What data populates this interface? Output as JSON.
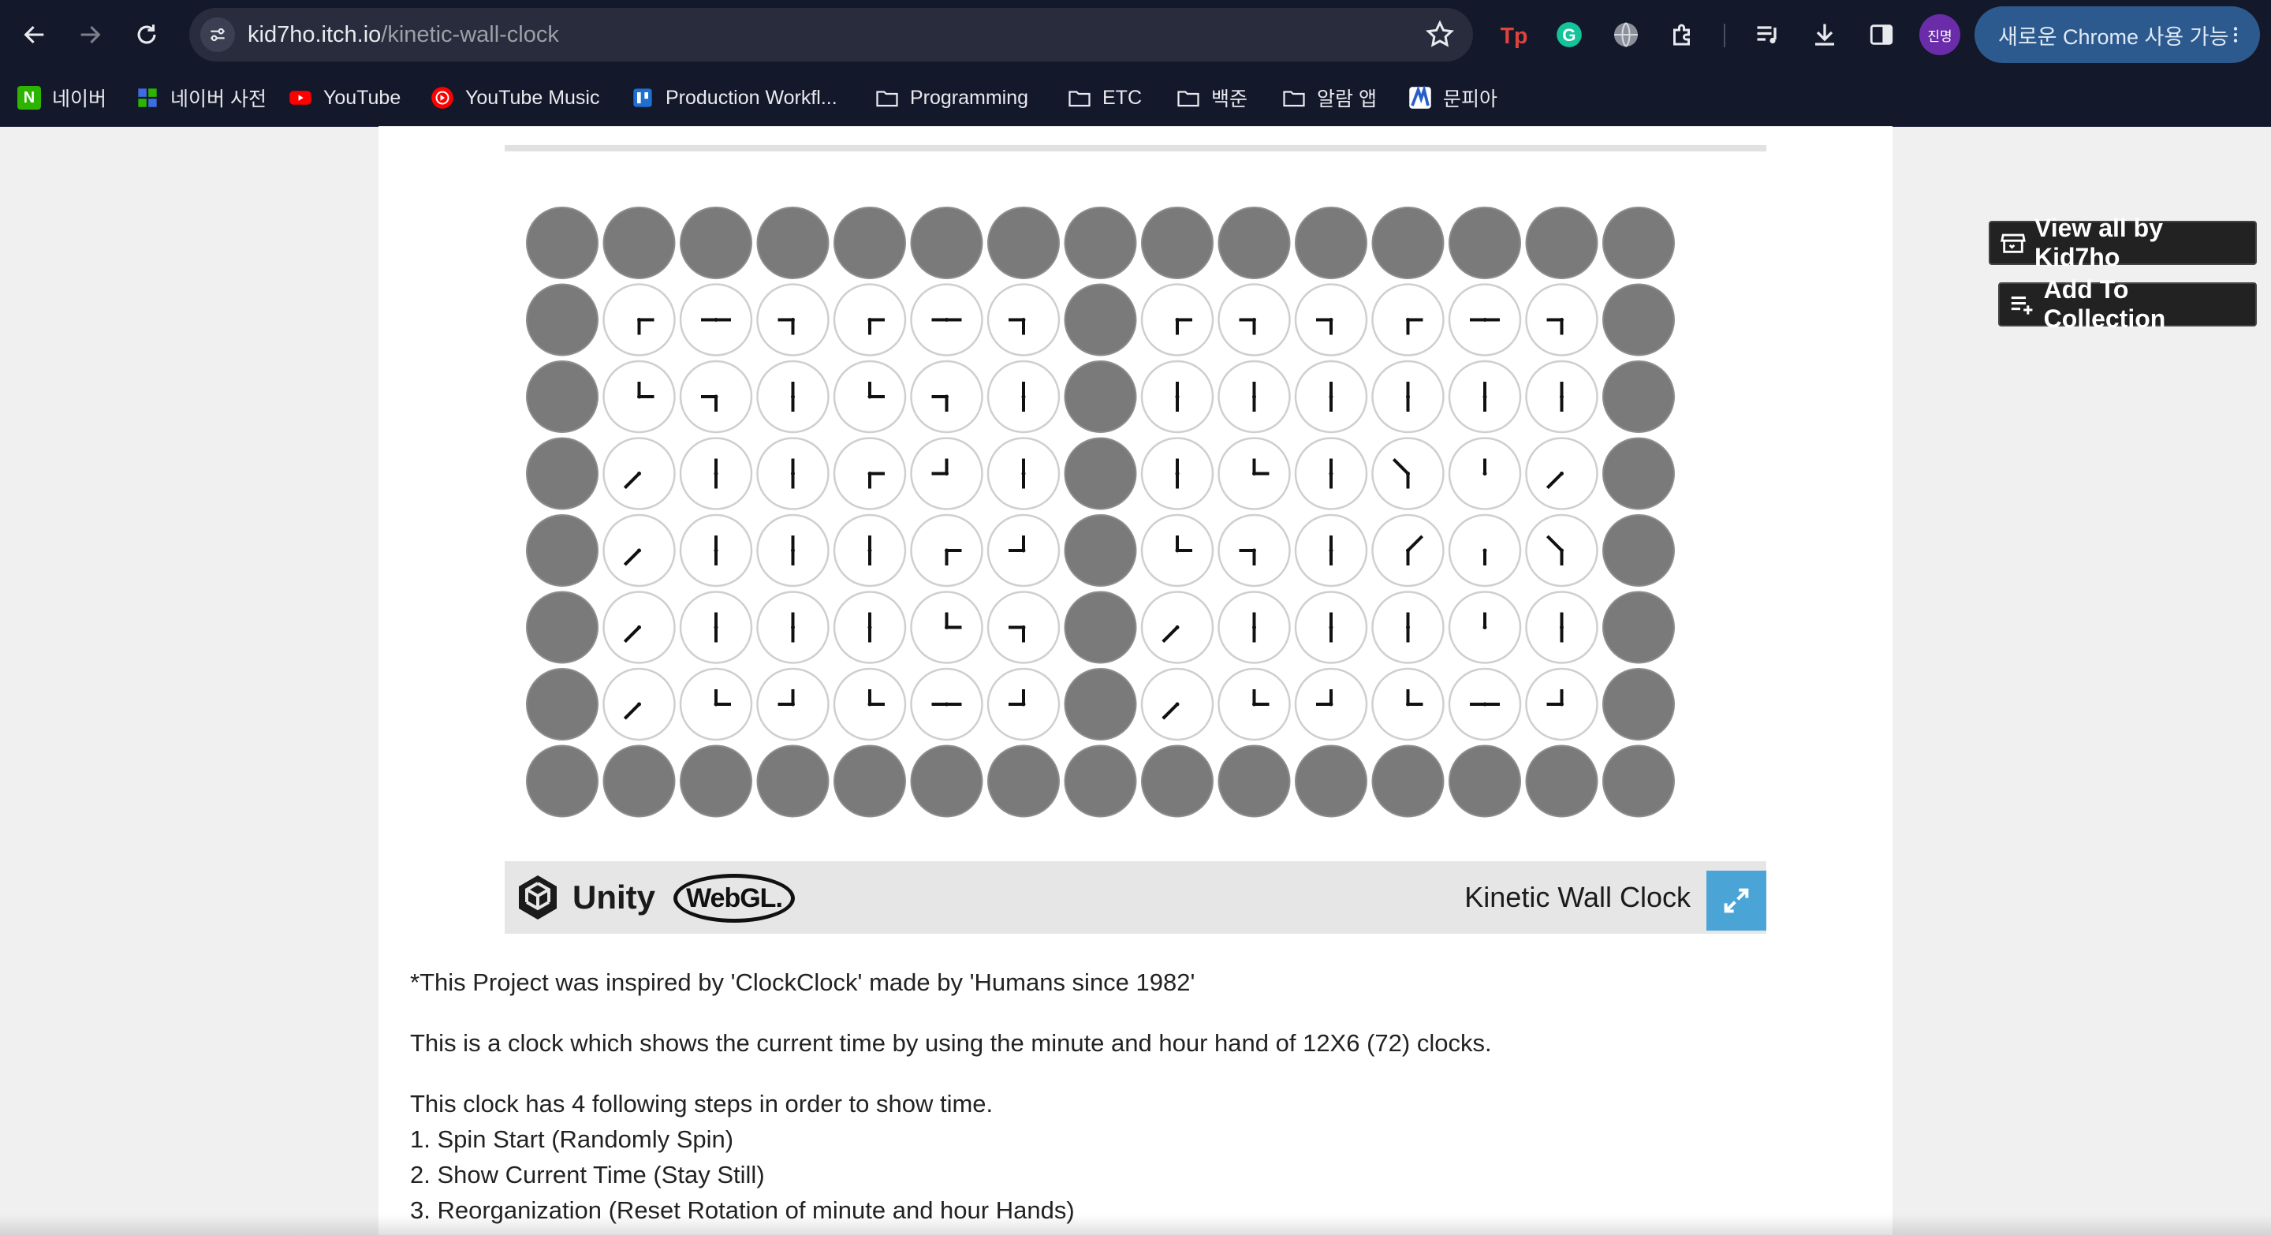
{
  "browser": {
    "url_domain": "kid7ho.itch.io",
    "url_path": "/kinetic-wall-clock",
    "profile_initials": "진명",
    "update_label": "새로운 Chrome 사용 가능",
    "bookmarks": [
      {
        "label": "네이버",
        "icon": "naver-icon"
      },
      {
        "label": "네이버 사전",
        "icon": "naver-dict-icon"
      },
      {
        "label": "YouTube",
        "icon": "youtube-icon"
      },
      {
        "label": "YouTube Music",
        "icon": "youtube-music-icon"
      },
      {
        "label": "Production Workfl...",
        "icon": "board-icon"
      },
      {
        "label": "Programming",
        "icon": "folder-icon"
      },
      {
        "label": "ETC",
        "icon": "folder-icon"
      },
      {
        "label": "백준",
        "icon": "folder-icon"
      },
      {
        "label": "알람 앱",
        "icon": "folder-icon"
      },
      {
        "label": "문피아",
        "icon": "munpia-icon"
      }
    ]
  },
  "game": {
    "title": "Kinetic Wall Clock",
    "engine_label": "Unity",
    "platform_label": "WebGL.",
    "clock_grid": [
      [
        "",
        "",
        "",
        "",
        "",
        "",
        "",
        "",
        "",
        "",
        "",
        "",
        "",
        "",
        ""
      ],
      [
        "",
        "RD",
        "LR",
        "LD",
        "RD",
        "LR",
        "LD",
        "",
        "RD",
        "LD",
        "LD",
        "RD",
        "LR",
        "LD",
        ""
      ],
      [
        "",
        "UR",
        "LD",
        "UD",
        "UR",
        "LD",
        "UD",
        "",
        "UD",
        "UD",
        "UD",
        "UD",
        "UD",
        "UD",
        ""
      ],
      [
        "",
        "SW",
        "UD",
        "UD",
        "RD",
        "UL",
        "UD",
        "",
        "UD",
        "UR",
        "UD",
        "NWD",
        "U",
        "SW",
        ""
      ],
      [
        "",
        "SW",
        "UD",
        "UD",
        "UD",
        "RD",
        "UL",
        "",
        "UR",
        "LD",
        "UD",
        "NED",
        "D",
        "NWD",
        ""
      ],
      [
        "",
        "SW",
        "UD",
        "UD",
        "UD",
        "UR",
        "LD",
        "",
        "SW",
        "UD",
        "UD",
        "UD",
        "U",
        "UD",
        ""
      ],
      [
        "",
        "SW",
        "UR",
        "UL",
        "UR",
        "LR",
        "UL",
        "",
        "SW",
        "UR",
        "UL",
        "UR",
        "LR",
        "UL",
        ""
      ],
      [
        "",
        "",
        "",
        "",
        "",
        "",
        "",
        "",
        "",
        "",
        "",
        "",
        "",
        "",
        ""
      ]
    ]
  },
  "sidebar": {
    "view_all_label": "View all by Kid7ho",
    "add_collection_label": "Add To Collection"
  },
  "description": {
    "line1": "*This Project was inspired by 'ClockClock' made by 'Humans since 1982'",
    "line2": "This is a clock which shows the current time by using the minute and hour hand of 12X6 (72) clocks.",
    "line3": "This clock has 4 following steps in order to show time.",
    "step1": "1. Spin Start (Randomly Spin)",
    "step2": "2. Show Current Time (Stay Still)",
    "step3": "3. Reorganization (Reset Rotation of minute and hour Hands)"
  },
  "colors": {
    "chrome_bg": "#14182b",
    "page_bg": "#f0f0f0",
    "frame_clock": "#7a7a7a",
    "clock_face": "#ffffff",
    "hand": "#111111",
    "fullscreen": "#4aa5d6"
  }
}
